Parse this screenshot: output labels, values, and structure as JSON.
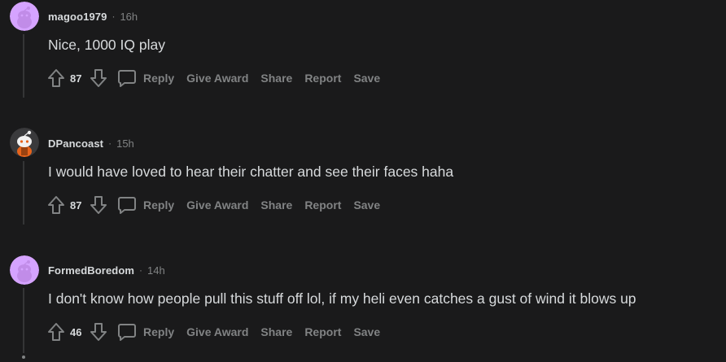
{
  "comments": [
    {
      "username": "magoo1979",
      "separator": "·",
      "time": "16h",
      "body": "Nice, 1000 IQ play",
      "score": "87",
      "avatar_color": "#d5a3ff"
    },
    {
      "username": "DPancoast",
      "separator": "·",
      "time": "15h",
      "body": "I would have loved to hear their chatter and see their faces haha",
      "score": "87",
      "avatar_color": "#3a3a3c"
    },
    {
      "username": "FormedBoredom",
      "separator": "·",
      "time": "14h",
      "body": "I don't know how people pull this stuff off lol, if my heli even catches a gust of wind it blows up",
      "score": "46",
      "avatar_color": "#d5a3ff"
    }
  ],
  "actions": {
    "reply": "Reply",
    "give_award": "Give Award",
    "share": "Share",
    "report": "Report",
    "save": "Save"
  },
  "colors": {
    "background": "#1a1a1b",
    "text": "#d7dadc",
    "muted": "#818384",
    "thread_line": "#343536"
  }
}
